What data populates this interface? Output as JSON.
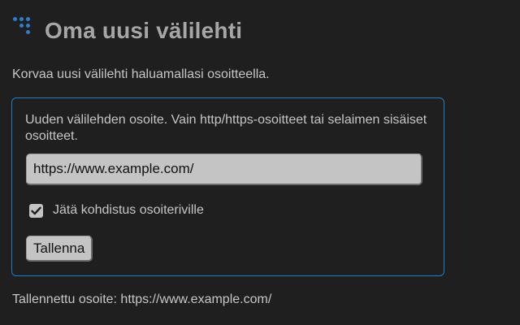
{
  "header": {
    "title": "Oma uusi välilehti",
    "logo_icon": "dots-logo-icon",
    "logo_color": "#2a7fd0"
  },
  "intro": "Korvaa uusi välilehti haluamallasi osoitteella.",
  "form": {
    "field_label": "Uuden välilehden osoite. Vain http/https-osoitteet tai selaimen sisäiset osoitteet.",
    "url_value": "https://www.example.com/",
    "checkbox_label": "Jätä kohdistus osoiteriville",
    "checkbox_checked": true,
    "save_label": "Tallenna",
    "border_color": "#1d7fc7"
  },
  "status": "Tallennettu osoite: https://www.example.com/"
}
